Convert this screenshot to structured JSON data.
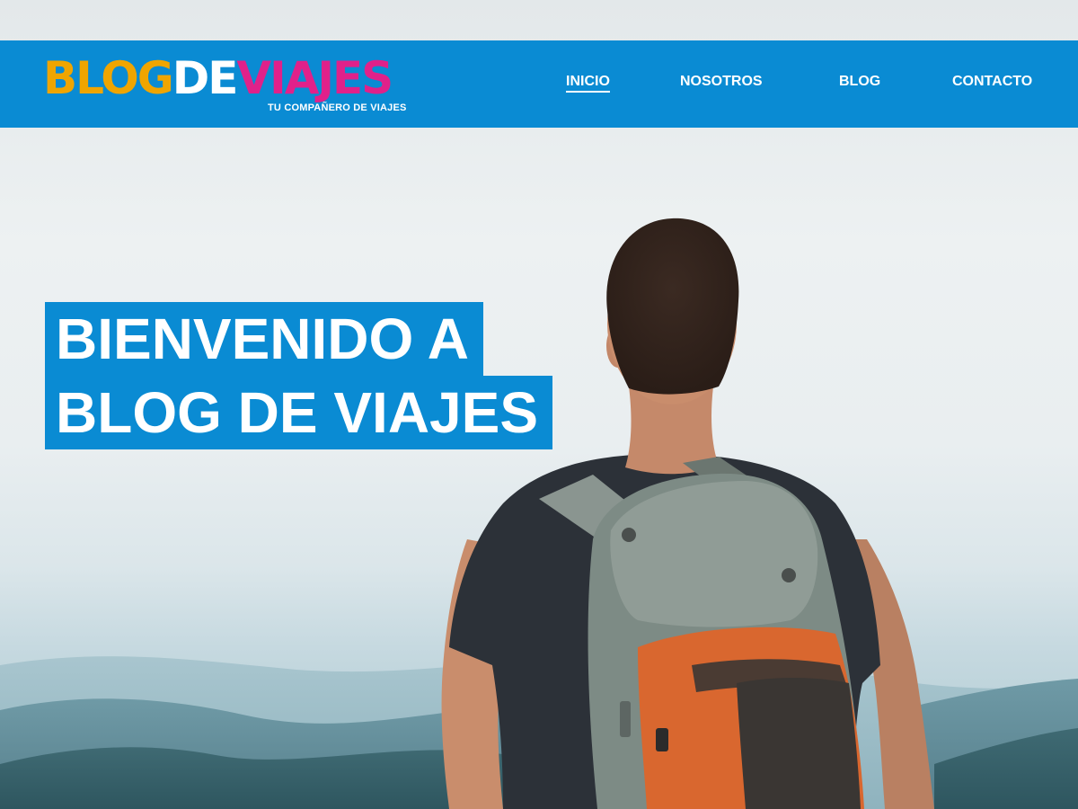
{
  "brand": {
    "logo_part1": "BLOG",
    "logo_part2": "DE",
    "logo_part3": "VIAJES",
    "tagline": "TU COMPAÑERO DE VIAJES",
    "colors": {
      "orange": "#f0a500",
      "white": "#ffffff",
      "pink": "#e0218a",
      "blue": "#0a8bd3"
    }
  },
  "nav": {
    "items": [
      {
        "label": "INICIO",
        "active": true
      },
      {
        "label": "NOSOTROS",
        "active": false
      },
      {
        "label": "BLOG",
        "active": false
      },
      {
        "label": "CONTACTO",
        "active": false
      }
    ]
  },
  "hero": {
    "title_line1": "BIENVENIDO A",
    "title_line2": "BLOG DE VIAJES",
    "image": "hiker-with-backpack-mountains"
  }
}
